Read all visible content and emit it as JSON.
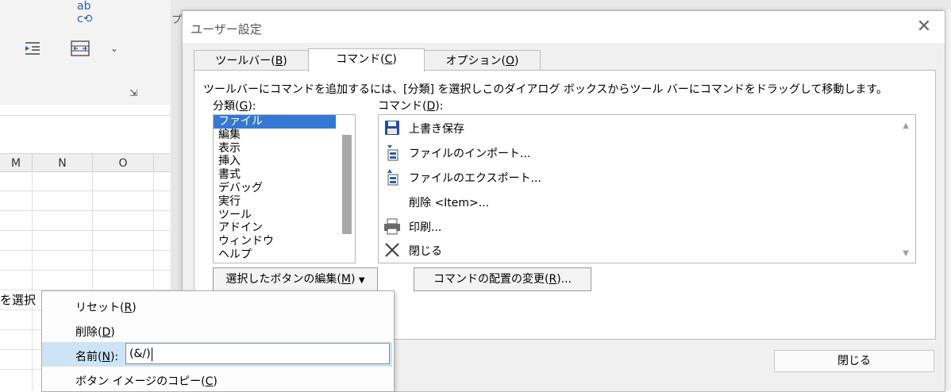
{
  "background": {
    "ribbon_icons": [
      "abc-check-icon",
      "indent-icon",
      "merge-cells-icon",
      "chevron-down-icon",
      "dialog-launcher-icon"
    ],
    "column_headers": [
      "M",
      "N",
      "O"
    ],
    "cell_text": "を選択",
    "partial_label": "プ"
  },
  "dialog": {
    "title": "ユーザー設定",
    "tabs": [
      {
        "label": "ツールバー(",
        "key": "B",
        "suffix": ")"
      },
      {
        "label": "コマンド(",
        "key": "C",
        "suffix": ")"
      },
      {
        "label": "オプション(",
        "key": "O",
        "suffix": ")"
      }
    ],
    "instruction": "ツールバーにコマンドを追加するには、[分類] を選択しこのダイアログ ボックスからツール バーにコマンドをドラッグして移動します。",
    "categories_label": {
      "text": "分類(",
      "key": "G",
      "suffix": "):"
    },
    "commands_label": {
      "text": "コマンド(",
      "key": "D",
      "suffix": "):"
    },
    "categories": [
      "ファイル",
      "編集",
      "表示",
      "挿入",
      "書式",
      "デバッグ",
      "実行",
      "ツール",
      "アドイン",
      "ウィンドウ",
      "ヘルプ"
    ],
    "commands": [
      {
        "label": "上書き保存",
        "icon": "save-icon"
      },
      {
        "label": "ファイルのインポート...",
        "icon": "import-file-icon"
      },
      {
        "label": "ファイルのエクスポート...",
        "icon": "export-file-icon"
      },
      {
        "label": "削除 <Item>...",
        "icon": ""
      },
      {
        "label": "印刷...",
        "icon": "printer-icon"
      },
      {
        "label": "閉じる",
        "icon": "close-x-icon"
      }
    ],
    "edit_button": {
      "text": "選択したボタンの編集(",
      "key": "M",
      "suffix": ")"
    },
    "layout_button": {
      "text": "コマンドの配置の変更(",
      "key": "R",
      "suffix": ")..."
    },
    "close_button": "閉じる"
  },
  "context_menu": {
    "items": [
      {
        "text": "リセット(",
        "key": "R",
        "suffix": ")"
      },
      {
        "text": "削除(",
        "key": "D",
        "suffix": ")"
      },
      {
        "text": "名前(",
        "key": "N",
        "suffix": "):"
      },
      {
        "text": "ボタン イメージのコピー(",
        "key": "C",
        "suffix": ")"
      }
    ],
    "name_value": "(&/)"
  },
  "colors": {
    "selection": "#3478d6",
    "menu_highlight": "#cde4f7"
  }
}
